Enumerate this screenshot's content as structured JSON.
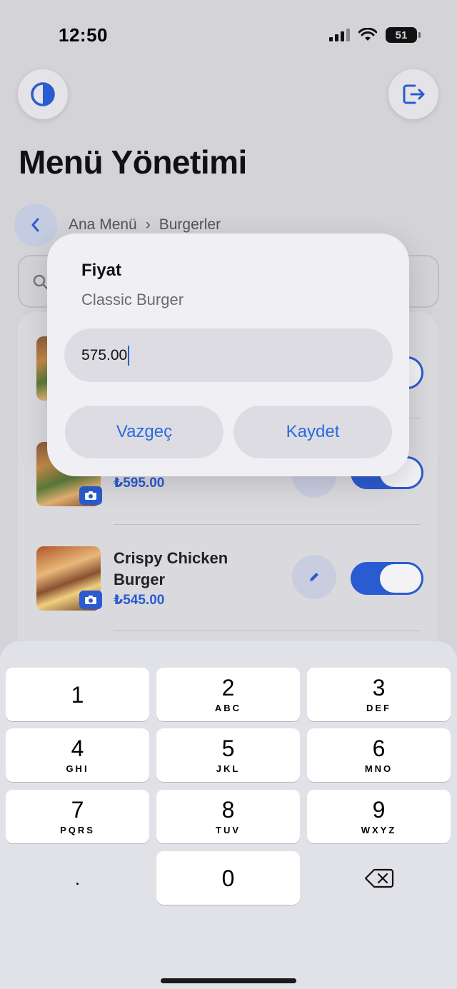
{
  "status": {
    "time": "12:50",
    "battery": "51"
  },
  "header": {
    "title": "Menü Yönetimi"
  },
  "breadcrumb": {
    "root": "Ana Menü",
    "separator": "›",
    "current": "Burgerler"
  },
  "items": [
    {
      "name": "",
      "price": ""
    },
    {
      "name": "",
      "price": "₺595.00"
    },
    {
      "name": "Crispy Chicken Burger",
      "price": "₺545.00"
    }
  ],
  "dialog": {
    "title": "Fiyat",
    "subtitle": "Classic Burger",
    "input_value": "575.00",
    "cancel_label": "Vazgeç",
    "save_label": "Kaydet"
  },
  "keypad": {
    "keys": [
      {
        "num": "1",
        "letters": ""
      },
      {
        "num": "2",
        "letters": "ABC"
      },
      {
        "num": "3",
        "letters": "DEF"
      },
      {
        "num": "4",
        "letters": "GHI"
      },
      {
        "num": "5",
        "letters": "JKL"
      },
      {
        "num": "6",
        "letters": "MNO"
      },
      {
        "num": "7",
        "letters": "PQRS"
      },
      {
        "num": "8",
        "letters": "TUV"
      },
      {
        "num": "9",
        "letters": "WXYZ"
      },
      {
        "num": ".",
        "letters": ""
      },
      {
        "num": "0",
        "letters": ""
      }
    ]
  },
  "colors": {
    "accent": "#2b5bd0",
    "link": "#2b6ae0"
  }
}
